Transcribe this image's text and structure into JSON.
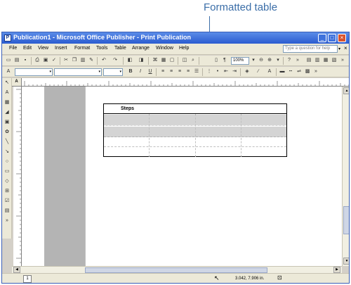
{
  "callout": {
    "label": "Formatted table"
  },
  "window": {
    "title": "Publication1 - Microsoft Office Publisher - Print Publication",
    "controls": {
      "minimize": "_",
      "maximize": "□",
      "close": "×"
    }
  },
  "menu": {
    "items": [
      "File",
      "Edit",
      "View",
      "Insert",
      "Format",
      "Tools",
      "Table",
      "Arrange",
      "Window",
      "Help"
    ],
    "help_placeholder": "Type a question for help",
    "doc_close": "×"
  },
  "toolbar": {
    "zoom": "100%"
  },
  "ruler": {
    "corner": "A"
  },
  "table": {
    "header": "Steps"
  },
  "status": {
    "page": "1",
    "position": "3.042, 7.906 in."
  },
  "colors": {
    "title_bar": "#2a5bd0",
    "callout": "#3b6ea8",
    "shaded_rows": "#d4d4d4"
  }
}
